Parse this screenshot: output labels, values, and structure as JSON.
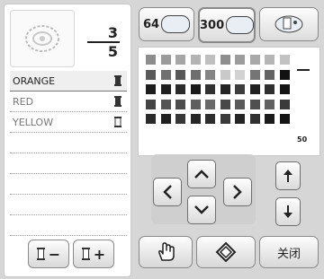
{
  "counter": {
    "current": "3",
    "total": "5"
  },
  "threads": [
    {
      "label": "ORANGE",
      "selected": true
    },
    {
      "label": "RED",
      "selected": false
    },
    {
      "label": "YELLOW",
      "selected": false
    }
  ],
  "palette_buttons": [
    {
      "count": "64",
      "icon": "thread-chart-icon"
    },
    {
      "count": "300",
      "icon": "thread-chart-icon"
    },
    {
      "count": "",
      "icon": "color-palette-icon"
    }
  ],
  "grid": {
    "label_bottom": "50"
  },
  "bottom_left": {
    "remove_label": "−",
    "add_label": "+"
  },
  "bottom_right": {
    "close_label": "关闭"
  },
  "colors": {
    "accent_border": "#8a8a8a",
    "panel_bg": "#ffffff"
  }
}
